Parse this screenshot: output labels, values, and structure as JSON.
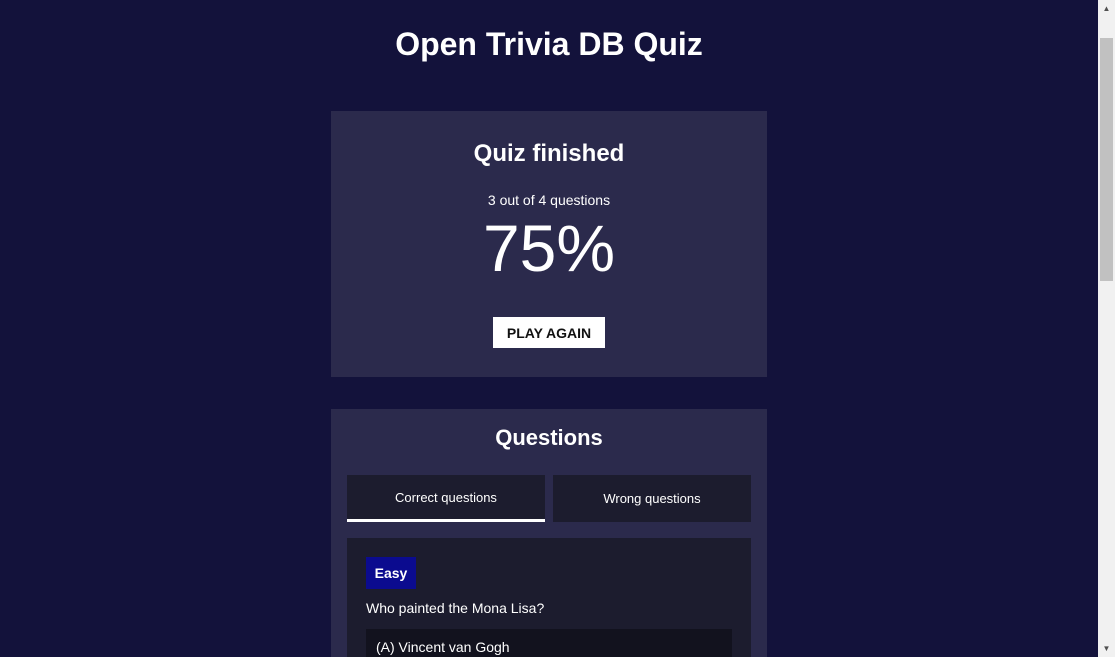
{
  "app": {
    "title": "Open Trivia DB Quiz"
  },
  "results": {
    "title": "Quiz finished",
    "score_text": "3 out of 4 questions",
    "score_percent": "75%",
    "play_again_label": "PLAY AGAIN"
  },
  "questions": {
    "title": "Questions",
    "tabs": [
      {
        "label": "Correct questions",
        "active": true
      },
      {
        "label": "Wrong questions",
        "active": false
      }
    ],
    "items": [
      {
        "difficulty": "Easy",
        "question": "Who painted the Mona Lisa?",
        "answers": [
          "(A) Vincent van Gogh"
        ]
      }
    ]
  },
  "colors": {
    "background": "#13123b",
    "card": "#2b2a4c",
    "panel": "#1c1c2e",
    "difficulty_easy": "#0b0b8f"
  },
  "scrollbar": {
    "up_icon": "triangle-up-icon",
    "down_icon": "triangle-down-icon"
  }
}
